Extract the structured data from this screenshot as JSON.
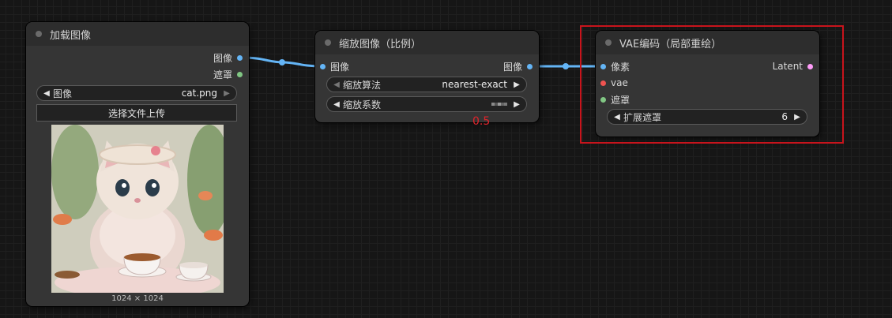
{
  "nodes": {
    "load_image": {
      "title": "加载图像",
      "outputs": [
        {
          "label": "图像",
          "color": "#64b5f6"
        },
        {
          "label": "遮罩",
          "color": "#81c784"
        }
      ],
      "image_widget": {
        "label": "图像",
        "value": "cat.png"
      },
      "upload_button": "选择文件上传",
      "image_size": "1024 × 1024"
    },
    "scale_image": {
      "title": "缩放图像（比例）",
      "inputs": [
        {
          "label": "图像",
          "color": "#64b5f6"
        }
      ],
      "outputs": [
        {
          "label": "图像",
          "color": "#64b5f6"
        }
      ],
      "method_widget": {
        "label": "缩放算法",
        "value": "nearest-exact"
      },
      "factor_widget": {
        "label": "缩放系数"
      }
    },
    "vae_encode": {
      "title": "VAE编码（局部重绘）",
      "inputs": [
        {
          "label": "像素",
          "color": "#64b5f6"
        },
        {
          "label": "vae",
          "color": "#ef5350"
        },
        {
          "label": "遮罩",
          "color": "#81c784"
        }
      ],
      "outputs": [
        {
          "label": "Latent",
          "color": "#ff9cf9"
        }
      ],
      "grow_widget": {
        "label": "扩展遮罩",
        "value": "6"
      }
    }
  },
  "annotation": {
    "value": "0.5",
    "color": "#e0242b"
  },
  "colors": {
    "image_wire": "#64b5f6",
    "highlight": "#c8141c"
  }
}
